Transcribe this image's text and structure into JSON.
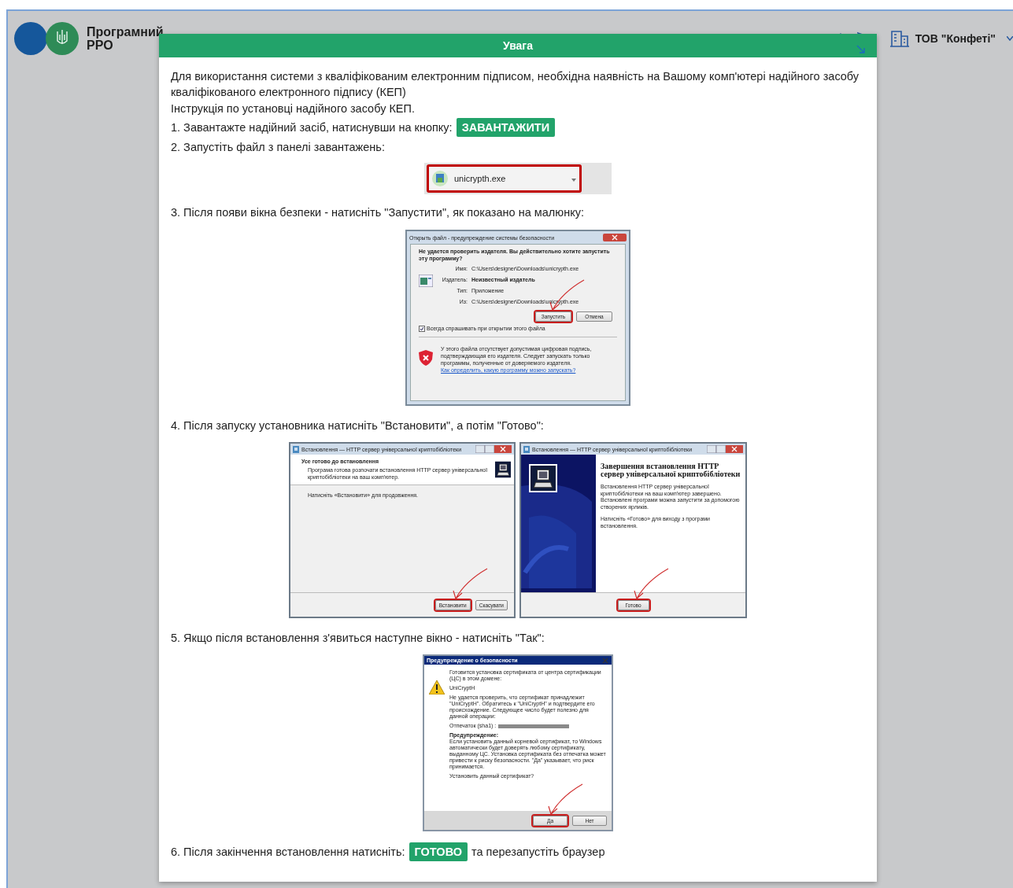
{
  "header": {
    "title_lines": [
      "Програмний",
      "РРО"
    ],
    "organization": "ТОВ \"Конфеті\""
  },
  "modal": {
    "title": "Увага",
    "intro": [
      "Для використання системи з кваліфікованим електронним підписом, необхідна наявність на Вашому комп'ютері надійного засобу кваліфікованого електронного підпису (КЕП)",
      "Інструкція по установці надійного засобу КЕП."
    ],
    "steps": [
      {
        "text": "1. Завантажте надійний засіб, натиснувши на кнопку:",
        "button": "ЗАВАНТАЖИТИ"
      },
      {
        "text": "2. Запустіть файл з панелі завантажень:",
        "illustration": {
          "kind": "download_bar",
          "file": "unicrypth.exe",
          "highlighted": true
        }
      },
      {
        "text": "3. Після появи вікна безпеки - натисніть \"Запустити\", як показано на малюнку:",
        "illustration": {
          "kind": "security_dialog",
          "title": "Открыть файл - предупреждение системы безопасности",
          "question": "Не удается проверить издателя.  Вы действительно хотите запустить эту программу?",
          "fields": [
            {
              "label": "Имя:",
              "value": "C:\\Users\\designer\\Downloads\\unicrypth.exe",
              "bold": false
            },
            {
              "label": "Издатель:",
              "value": "Неизвестный издатель",
              "bold": true
            },
            {
              "label": "Тип:",
              "value": "Приложение",
              "bold": false
            },
            {
              "label": "Из:",
              "value": "C:\\Users\\designer\\Downloads\\unicrypth.exe",
              "bold": false
            }
          ],
          "buttons": [
            {
              "label": "Запустить",
              "highlighted": true
            },
            {
              "label": "Отмена",
              "highlighted": false
            }
          ],
          "checkbox": {
            "label": "Всегда спрашивать при открытии этого файла",
            "checked": true
          },
          "warning": "У этого файла отсутствует допустимая цифровая подпись, подтверждающая его издателя. Следует запускать только программы, полученные от доверяемого издателя.",
          "link": "Как определить, какую программу можно запускать?"
        }
      },
      {
        "text": "4. Після запуску установника натисніть \"Встановити\", а потім \"Готово\":",
        "illustration": {
          "kind": "installer_pair",
          "windows": [
            {
              "kind": "ready",
              "title": "Встановлення — HTTP сервер універсальної криптобібліотеки",
              "heading": "Усе готово до встановлення",
              "subheading": "Програма готова розпочати встановлення HTTP сервер універсальної криптобібліотеки на ваш комп'ютер.",
              "body": [
                "Натисніть «Встановити» для продовження."
              ],
              "buttons": [
                {
                  "label": "Встановити",
                  "highlighted": true
                },
                {
                  "label": "Скасувати",
                  "highlighted": false
                }
              ]
            },
            {
              "kind": "finished",
              "title": "Встановлення — HTTP сервер універсальної криптобібліотеки",
              "heading": "Завершення встановлення HTTP сервер універсальної криптобібліотеки",
              "body": [
                "Встановлення HTTP сервер універсальної криптобібліотеки на ваш комп'ютер завершено. Встановлені програми можна запустити за допомогою створених ярликів.",
                "Натисніть «Готово» для виходу з програми встановлення."
              ],
              "buttons": [
                {
                  "label": "Готово",
                  "highlighted": true
                }
              ]
            }
          ]
        }
      },
      {
        "text": "5. Якщо після встановлення з'явиться наступне вікно - натисніть \"Так\":",
        "illustration": {
          "kind": "certificate_dialog",
          "title": "Предупреждение о безопасности",
          "paragraphs": [
            {
              "text": "Готовится установка сертификата от центра сертификации (ЦС) в этом домене:",
              "bold": false
            },
            {
              "text": "UniCryptH",
              "bold": false
            },
            {
              "text": "Не удается проверить, что сертификат принадлежит \"UniCryptH\". Обратитесь к \"UniCryptH\" и подтвердите его происхождение. Следующее число будет полезно для данной операции:",
              "bold": false
            },
            {
              "text": "Отпечаток (sha1) :",
              "bold": false
            },
            {
              "text": "Предупреждение:",
              "bold": true
            },
            {
              "text": "Если установить данный корневой сертификат, то Windows автоматически будет доверять любому сертификату, выданному ЦС. Установка сертификата без отпечатка может привести к риску безопасности. \"Да\" указывает, что риск принимается.",
              "bold": false
            },
            {
              "text": "Установить данный сертификат?",
              "bold": false
            }
          ],
          "buttons": [
            {
              "label": "Да",
              "highlighted": true
            },
            {
              "label": "Нет",
              "highlighted": false
            }
          ]
        }
      },
      {
        "text": "6. Після закінчення встановлення натисніть:",
        "button": "ГОТОВО",
        "trailing": "та перезапустіть браузер"
      }
    ]
  }
}
